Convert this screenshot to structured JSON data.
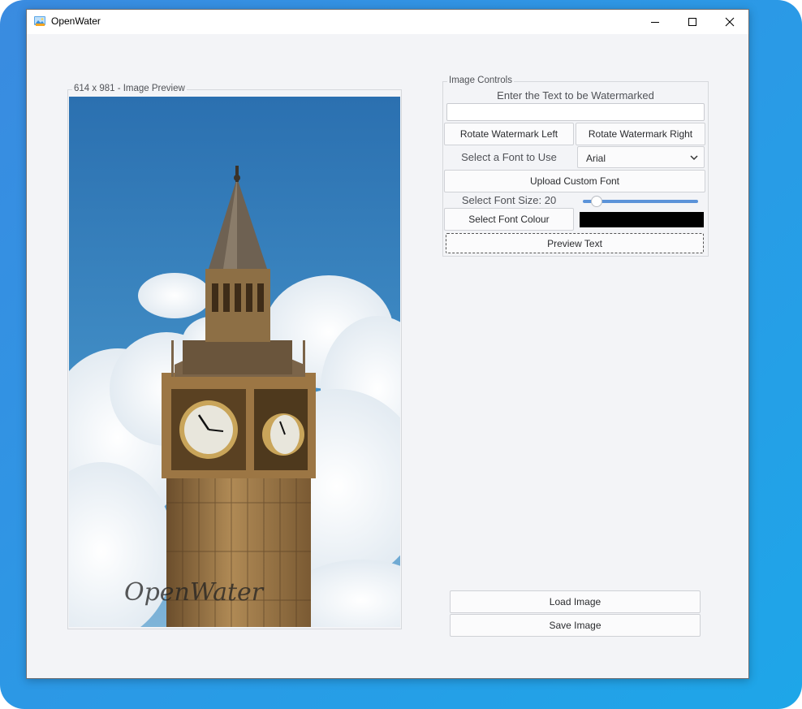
{
  "window": {
    "title": "OpenWater",
    "icon": "image-app-icon"
  },
  "preview": {
    "group_label": "614 x 981 - Image Preview",
    "watermark_text": "OpenWater"
  },
  "controls": {
    "group_label": "Image Controls",
    "heading": "Enter the Text to be Watermarked",
    "text_value": "",
    "rotate_left_label": "Rotate Watermark Left",
    "rotate_right_label": "Rotate Watermark Right",
    "font_select_label": "Select a Font to Use",
    "font_selected": "Arial",
    "upload_font_label": "Upload Custom Font",
    "font_size_label": "Select Font Size: 20",
    "font_size_value": 20,
    "font_colour_label": "Select Font Colour",
    "font_colour": "#000000",
    "preview_text_label": "Preview Text"
  },
  "actions": {
    "load_label": "Load Image",
    "save_label": "Save Image"
  },
  "colors": {
    "accent": "#5b93d9",
    "window_bg": "#f3f4f7",
    "desktop_gradient": [
      "#3a8be0",
      "#1ea6e8"
    ]
  }
}
